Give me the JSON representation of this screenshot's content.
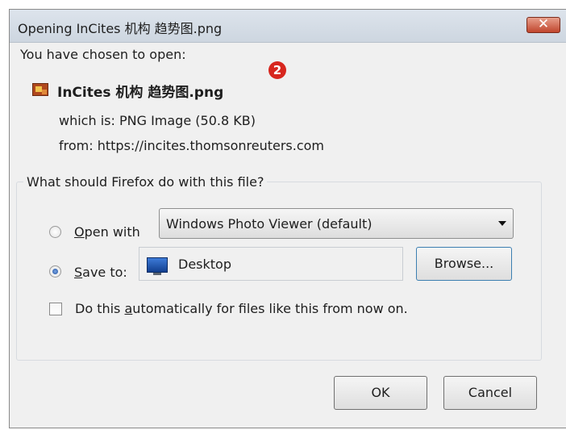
{
  "window": {
    "title": "Opening InCites 机构 趋势图.png",
    "close_glyph": "✕"
  },
  "header": {
    "chosen_text": "You have chosen to open:",
    "file_name": "InCites 机构 趋势图.png",
    "which_is_label": "which is:",
    "which_is_value": "PNG Image (50.8 KB)",
    "from_label": "from:",
    "from_value": "https://incites.thomsonreuters.com",
    "badge": "2"
  },
  "action_group": {
    "label": "What should Firefox do with this file?",
    "open_with": {
      "label_first": "O",
      "label_rest": "pen with",
      "selected": false,
      "application": "Windows Photo Viewer (default)"
    },
    "save_to": {
      "label_first": "S",
      "label_rest": "ave to:",
      "selected": true,
      "location": "Desktop",
      "browse_label": "Browse..."
    },
    "auto_checkbox": {
      "label_pre": "Do this ",
      "label_accel": "a",
      "label_post": "utomatically for files like this from now on.",
      "checked": false
    }
  },
  "buttons": {
    "ok": "OK",
    "cancel": "Cancel"
  },
  "colors": {
    "badge": "#d7261e",
    "close_button": "#c0462d",
    "browse_border": "#3c7fb1"
  },
  "icons": {
    "file": "png-file-icon",
    "desktop": "desktop-icon",
    "close": "close-icon",
    "dropdown": "chevron-down-icon"
  }
}
